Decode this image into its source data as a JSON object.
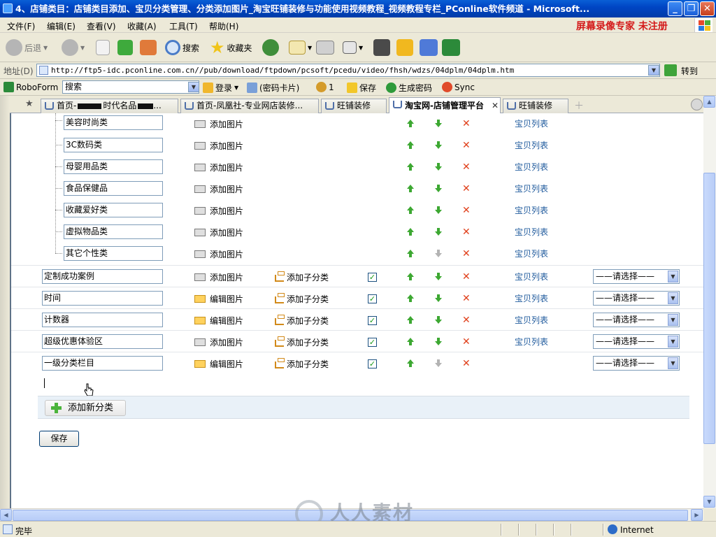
{
  "window": {
    "title": "4、店铺类目：店铺类目添加、宝贝分类管理、分类添加图片_淘宝旺铺装修与功能使用视频教程_视频教程专栏_PConline软件频道 - Microsoft..."
  },
  "menu": [
    "文件(F)",
    "编辑(E)",
    "查看(V)",
    "收藏(A)",
    "工具(T)",
    "帮助(H)"
  ],
  "unregistered": "屏幕录像专家 未注册",
  "toolbar": {
    "back": "后退",
    "search": "搜索",
    "favorites": "收藏夹"
  },
  "address": {
    "label": "地址(D)",
    "url": "http://ftp5-idc.pconline.com.cn//pub/download/ftpdown/pcsoft/pcedu/video/fhsh/wdzs/04dplm/04dplm.htm",
    "go": "转到"
  },
  "roboform": {
    "brand": "RoboForm",
    "search": "搜索",
    "login": "登录",
    "passcard": "(密码卡片)",
    "count": "1",
    "save": "保存",
    "generate": "生成密码",
    "sync": "Sync"
  },
  "tabs": [
    {
      "label": "首页-",
      "extra": "时代名品"
    },
    {
      "label": "首页-凤凰社-专业网店装修..."
    },
    {
      "label": "旺铺装修"
    },
    {
      "label": "淘宝网-店铺管理平台"
    },
    {
      "label": "旺铺装修"
    }
  ],
  "actions": {
    "add_image": "添加图片",
    "edit_image": "编辑图片",
    "add_sub": "添加子分类",
    "item_list": "宝贝列表",
    "select_default": "——请选择——"
  },
  "subcategories": [
    "美容时尚类",
    "3C数码类",
    "母婴用品类",
    "食品保健品",
    "收藏爱好类",
    "虚拟物品类",
    "其它个性类"
  ],
  "categories": [
    {
      "name": "定制成功案例",
      "image_action": "添加图片",
      "image_type": "plain",
      "down_enabled": true,
      "has_list": true
    },
    {
      "name": "时间",
      "image_action": "编辑图片",
      "image_type": "folder",
      "down_enabled": true,
      "has_list": true
    },
    {
      "name": "计数器",
      "image_action": "编辑图片",
      "image_type": "folder",
      "down_enabled": true,
      "has_list": true
    },
    {
      "name": "超级优惠体验区",
      "image_action": "添加图片",
      "image_type": "plain",
      "down_enabled": true,
      "has_list": true
    },
    {
      "name": "一级分类栏目",
      "image_action": "编辑图片",
      "image_type": "folder",
      "down_enabled": false,
      "has_list": false
    }
  ],
  "add_category": "添加新分类",
  "save": "保存",
  "status": {
    "text": "完毕",
    "zone": "Internet"
  },
  "watermark": "人人素材"
}
